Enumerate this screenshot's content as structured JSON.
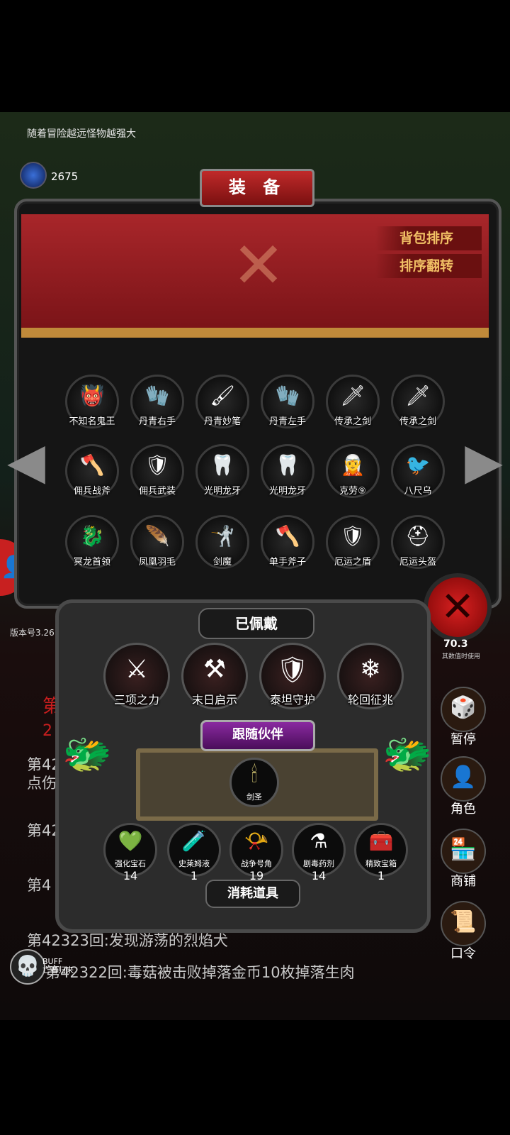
{
  "hint": "随着冒险越远怪物越强大",
  "gems": {
    "count": "2675",
    "label": "宝石"
  },
  "version": "版本号3.26",
  "equip": {
    "title": "装 备",
    "sort_pack": "背包排序",
    "sort_flip": "排序翻转",
    "items": [
      {
        "label": "不知名鬼王",
        "icon": "demon-king-icon",
        "glyph": "👹"
      },
      {
        "label": "丹青右手",
        "icon": "glove-icon",
        "glyph": "🧤"
      },
      {
        "label": "丹青妙笔",
        "icon": "brush-icon",
        "glyph": "🖌"
      },
      {
        "label": "丹青左手",
        "icon": "glove-icon",
        "glyph": "🧤"
      },
      {
        "label": "传承之剑",
        "icon": "sword-icon",
        "glyph": "🗡"
      },
      {
        "label": "传承之剑",
        "icon": "sword-icon",
        "glyph": "🗡"
      },
      {
        "label": "佣兵战斧",
        "icon": "axe-icon",
        "glyph": "🪓"
      },
      {
        "label": "佣兵武装",
        "icon": "armor-icon",
        "glyph": "🛡"
      },
      {
        "label": "光明龙牙",
        "icon": "fang-icon",
        "glyph": "🦷"
      },
      {
        "label": "光明龙牙",
        "icon": "fang-icon",
        "glyph": "🦷"
      },
      {
        "label": "克劳⑨",
        "icon": "character-icon",
        "glyph": "🧝"
      },
      {
        "label": "八尺乌",
        "icon": "crow-icon",
        "glyph": "🐦"
      },
      {
        "label": "冥龙首领",
        "icon": "bone-dragon-icon",
        "glyph": "🐉"
      },
      {
        "label": "凤凰羽毛",
        "icon": "feather-icon",
        "glyph": "🪶"
      },
      {
        "label": "剑魔",
        "icon": "sword-demon-icon",
        "glyph": "🤺"
      },
      {
        "label": "单手斧子",
        "icon": "axe-icon",
        "glyph": "🪓"
      },
      {
        "label": "厄运之盾",
        "icon": "shield-icon",
        "glyph": "🛡"
      },
      {
        "label": "厄运头盔",
        "icon": "helmet-icon",
        "glyph": "⛑"
      }
    ]
  },
  "equipped": {
    "title": "已佩戴",
    "items": [
      {
        "label": "三项之力",
        "icon": "triforce-icon",
        "glyph": "⚔"
      },
      {
        "label": "末日启示",
        "icon": "doom-axe-icon",
        "glyph": "⚒"
      },
      {
        "label": "泰坦守护",
        "icon": "titan-armor-icon",
        "glyph": "🛡"
      },
      {
        "label": "轮回征兆",
        "icon": "ice-scepter-icon",
        "glyph": "❄"
      }
    ]
  },
  "companion": {
    "title": "跟随伙伴",
    "label": "剑圣",
    "icon": "sword-saint-icon",
    "glyph": "🕯"
  },
  "consumables": {
    "title": "消耗道具",
    "items": [
      {
        "label": "强化宝石",
        "count": "14",
        "icon": "green-gem-icon",
        "glyph": "💚"
      },
      {
        "label": "史莱姆液",
        "count": "1",
        "icon": "potion-icon",
        "glyph": "🧪"
      },
      {
        "label": "战争号角",
        "count": "19",
        "icon": "horn-icon",
        "glyph": "📯"
      },
      {
        "label": "剧毒药剂",
        "count": "14",
        "icon": "poison-icon",
        "glyph": "⚗"
      },
      {
        "label": "精致宝箱",
        "count": "1",
        "icon": "chest-icon",
        "glyph": "🧰"
      }
    ]
  },
  "counter": {
    "value": "70.3",
    "sub": "其数值时使用"
  },
  "side_menu": [
    {
      "label": "暂停",
      "icon": "dice-icon",
      "glyph": "🎲"
    },
    {
      "label": "角色",
      "icon": "hooded-figure-icon",
      "glyph": "👤"
    },
    {
      "label": "商铺",
      "icon": "shop-icon",
      "glyph": "🏪"
    },
    {
      "label": "口令",
      "icon": "scroll-icon",
      "glyph": "📜"
    }
  ],
  "log": {
    "partial_1": "第",
    "partial_2": "2",
    "partial_3": "第42",
    "partial_4": "点伤",
    "partial_5": "第42",
    "partial_6": "第4",
    "line_1": "第42323回:发现游荡的烈焰犬",
    "line_2": "第42322回:毒菇被击败掉落金币10枚掉落生肉"
  },
  "buff": {
    "title": "BUFF",
    "label": "亡者归来"
  },
  "colors": {
    "banner": "#a8262a",
    "accent_gold": "#f1c065",
    "close_red": "#d82020",
    "log_red": "#c81e1e"
  }
}
